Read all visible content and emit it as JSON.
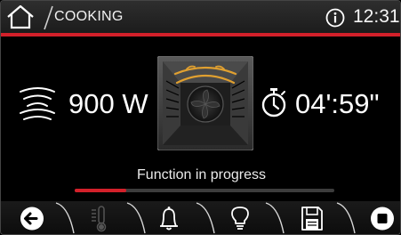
{
  "header": {
    "title": "COOKING",
    "time": "12:31",
    "home_icon": "home-icon",
    "info_icon": "info-icon"
  },
  "cooking": {
    "power": "900 W",
    "power_icon": "microwave-waves-icon",
    "timer": "04':59\"",
    "timer_icon": "stopwatch-icon",
    "oven_icon": "oven-fan-icon",
    "status": "Function in progress",
    "progress": 0.2
  },
  "footer": {
    "buttons": [
      {
        "name": "back-button",
        "icon": "back-arrow-icon",
        "enabled": true
      },
      {
        "name": "probe-button",
        "icon": "thermometer-icon",
        "enabled": false
      },
      {
        "name": "alarm-button",
        "icon": "bell-icon",
        "enabled": true
      },
      {
        "name": "light-button",
        "icon": "lightbulb-icon",
        "enabled": true
      },
      {
        "name": "save-button",
        "icon": "floppy-disk-icon",
        "enabled": true
      },
      {
        "name": "stop-button",
        "icon": "stop-icon",
        "enabled": true
      }
    ]
  },
  "colors": {
    "accent": "#d3202a",
    "fan": "#e0a030",
    "background": "#000000"
  }
}
